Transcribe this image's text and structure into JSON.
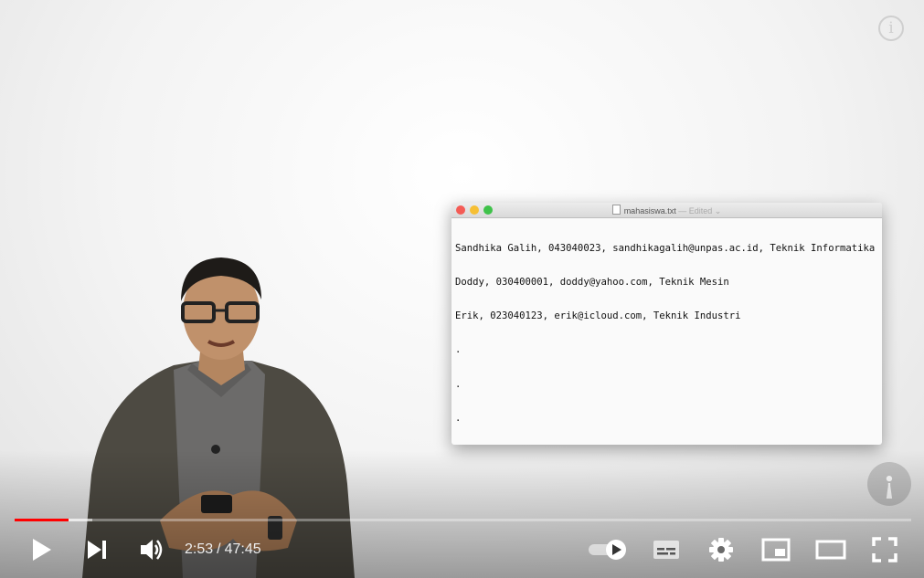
{
  "player": {
    "time": {
      "current": "2:53",
      "separator": "/",
      "duration": "47:45"
    },
    "progress": {
      "played_fraction": 0.06,
      "buffered_fraction": 0.087
    },
    "colors": {
      "played": "#ff0000",
      "controls": "#ffffff"
    },
    "icons": {
      "play": "play-icon",
      "next": "next-icon",
      "volume": "volume-icon",
      "autoplay": "autoplay-toggle-icon",
      "subtitles": "subtitles-icon",
      "settings": "gear-icon",
      "miniplayer": "miniplayer-icon",
      "theater": "theater-mode-icon",
      "fullscreen": "fullscreen-icon",
      "info": "info-icon"
    },
    "info_label": "i"
  },
  "editor": {
    "filename": "mahasiswa.txt",
    "status": "— Edited ⌄",
    "lines": [
      "Sandhika Galih, 043040023, sandhikagalih@unpas.ac.id, Teknik Informatika",
      "Doddy, 030400001, doddy@yahoo.com, Teknik Mesin",
      "Erik, 023040123, erik@icloud.com, Teknik Industri",
      ".",
      ".",
      "."
    ]
  }
}
